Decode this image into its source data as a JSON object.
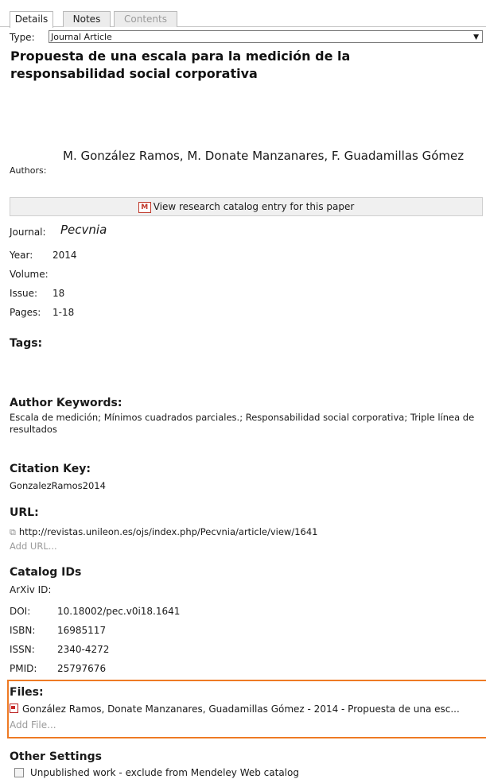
{
  "tabs": [
    {
      "label": "Details"
    },
    {
      "label": "Notes"
    },
    {
      "label": "Contents"
    }
  ],
  "type": {
    "label": "Type:",
    "value": "Journal Article"
  },
  "title": "Propuesta de una escala para la medición de la responsabilidad social corporativa",
  "authors": {
    "label": "Authors:",
    "value": "M. González Ramos, M. Donate Manzanares, F. Guadamillas Gómez"
  },
  "catalog_button": {
    "label": "View research catalog entry for this paper"
  },
  "fields": {
    "journal": {
      "label": "Journal:",
      "value": "Pecvnia"
    },
    "year": {
      "label": "Year:",
      "value": "2014"
    },
    "volume": {
      "label": "Volume:",
      "value": ""
    },
    "issue": {
      "label": "Issue:",
      "value": "18"
    },
    "pages": {
      "label": "Pages:",
      "value": "1-18"
    }
  },
  "tags": {
    "heading": "Tags:"
  },
  "author_keywords": {
    "heading": "Author Keywords:",
    "value": "Escala de medición; Mínimos cuadrados parciales.; Responsabilidad social corporativa; Triple línea de resultados"
  },
  "citation_key": {
    "heading": "Citation Key:",
    "value": "GonzalezRamos2014"
  },
  "url": {
    "heading": "URL:",
    "value": "http://revistas.unileon.es/ojs/index.php/Pecvnia/article/view/1641",
    "add_label": "Add URL..."
  },
  "catalog_ids": {
    "heading": "Catalog IDs",
    "arxiv": {
      "label": "ArXiv ID:",
      "value": ""
    },
    "doi": {
      "label": "DOI:",
      "value": "10.18002/pec.v0i18.1641"
    },
    "isbn": {
      "label": "ISBN:",
      "value": "16985117"
    },
    "issn": {
      "label": "ISSN:",
      "value": "2340-4272"
    },
    "pmid": {
      "label": "PMID:",
      "value": "25797676"
    }
  },
  "files": {
    "heading": "Files:",
    "file_name": "González Ramos, Donate Manzanares, Guadamillas Gómez - 2014 - Propuesta de una esc...",
    "add_label": "Add File..."
  },
  "other_settings": {
    "heading": "Other Settings",
    "unpublished_label": "Unpublished work - exclude from Mendeley Web catalog",
    "unpublished_checked": false
  },
  "colors": {
    "highlight": "#ee7a24",
    "pdf_icon": "#c62828"
  }
}
